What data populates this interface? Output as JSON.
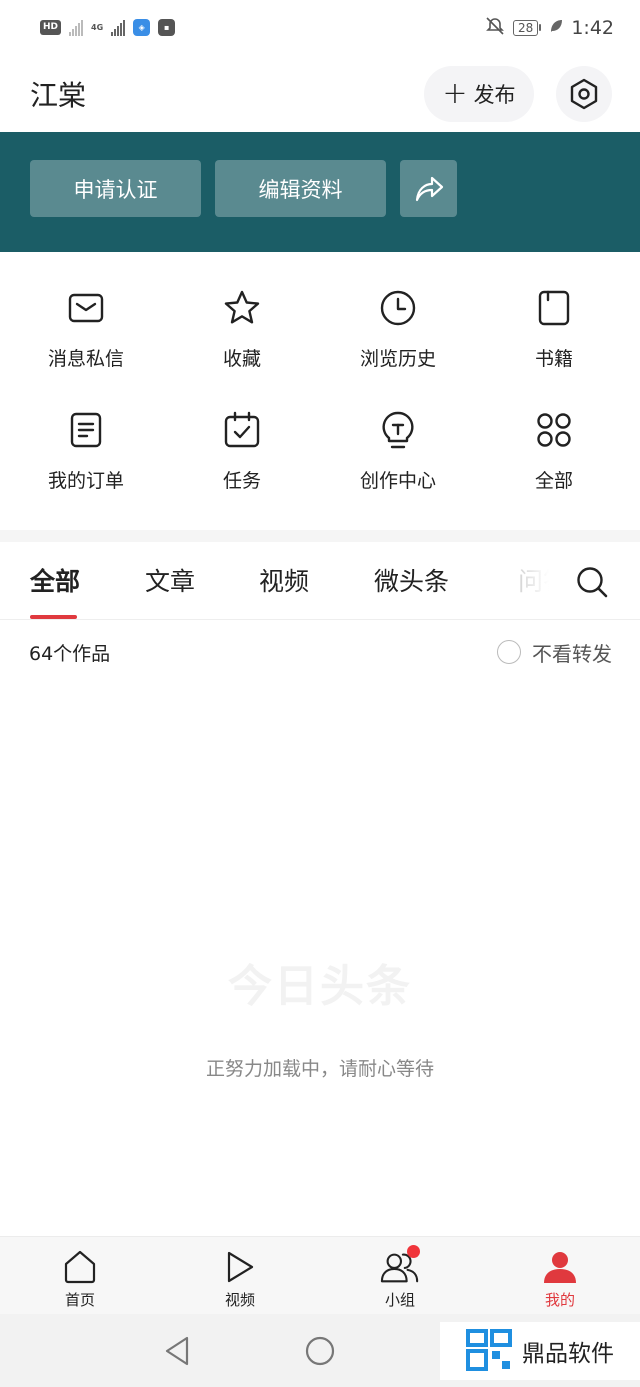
{
  "status_bar": {
    "hd_label": "HD",
    "network_label": "4G",
    "battery": "28",
    "time": "1:42"
  },
  "header": {
    "username": "江棠",
    "publish_label": "发布"
  },
  "banner": {
    "verify_label": "申请认证",
    "edit_profile_label": "编辑资料"
  },
  "grid": {
    "items": [
      {
        "label": "消息私信",
        "icon": "mail-icon"
      },
      {
        "label": "收藏",
        "icon": "star-icon"
      },
      {
        "label": "浏览历史",
        "icon": "clock-icon"
      },
      {
        "label": "书籍",
        "icon": "book-icon"
      },
      {
        "label": "我的订单",
        "icon": "order-icon"
      },
      {
        "label": "任务",
        "icon": "calendar-check-icon"
      },
      {
        "label": "创作中心",
        "icon": "lightbulb-icon"
      },
      {
        "label": "全部",
        "icon": "grid-icon"
      }
    ]
  },
  "tabs": {
    "items": [
      {
        "label": "全部",
        "active": true
      },
      {
        "label": "文章",
        "active": false
      },
      {
        "label": "视频",
        "active": false
      },
      {
        "label": "微头条",
        "active": false
      },
      {
        "label": "问答",
        "active": false
      }
    ]
  },
  "filter": {
    "works_count": "64个作品",
    "hide_repost_label": "不看转发",
    "hide_repost_checked": false
  },
  "loading": {
    "logo_text": "今日头条",
    "message": "正努力加载中，请耐心等待"
  },
  "bottom_nav": {
    "items": [
      {
        "label": "首页",
        "active": false
      },
      {
        "label": "视频",
        "active": false
      },
      {
        "label": "小组",
        "active": false,
        "badge": true
      },
      {
        "label": "我的",
        "active": true
      }
    ]
  },
  "watermark": {
    "text": "鼎品软件"
  },
  "colors": {
    "banner": "#1b5d66",
    "accent": "#e0393e"
  }
}
